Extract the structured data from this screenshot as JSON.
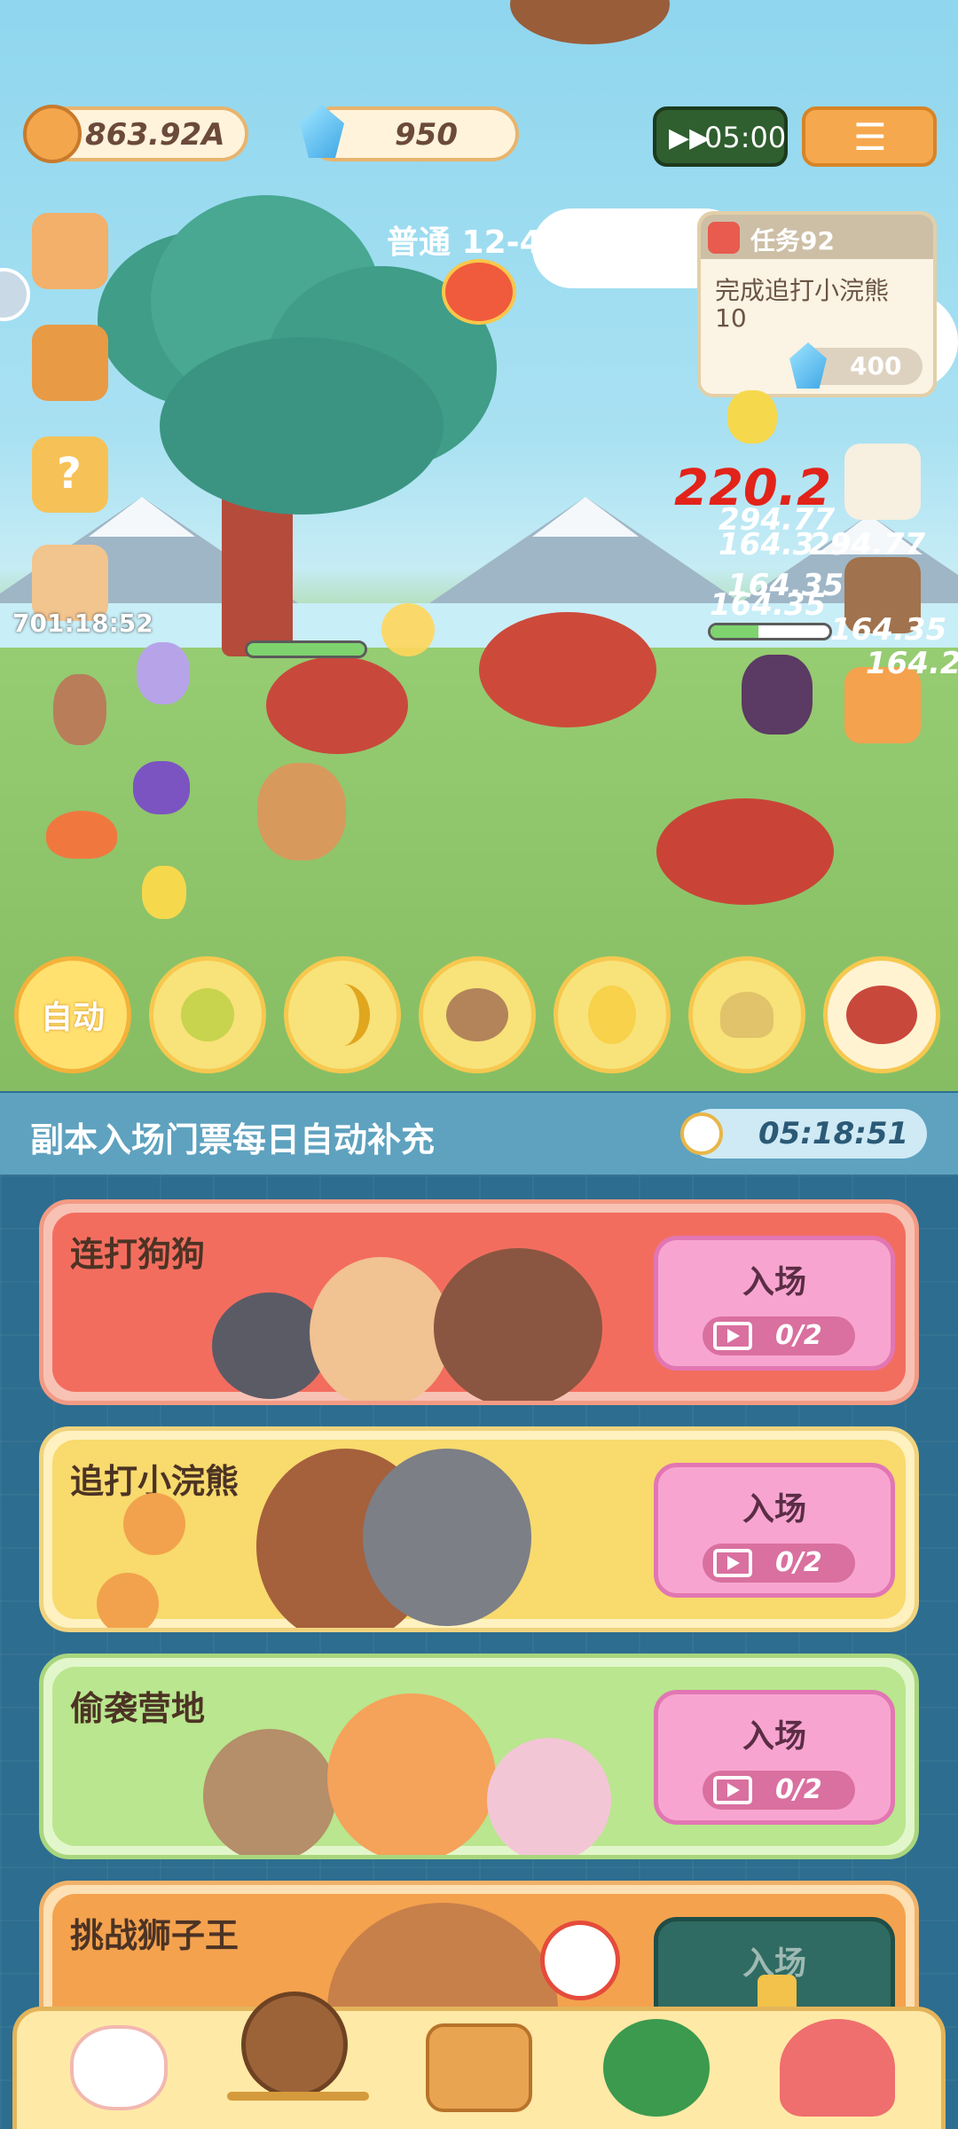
{
  "hud": {
    "coins": "863.92A",
    "gems": "950",
    "speed_timer": "05:00",
    "stage": "普通  12-4"
  },
  "side": {
    "timer": "701:18:52"
  },
  "quest": {
    "title": "任务92",
    "desc": "完成追打小浣熊",
    "count": "10",
    "reward": "400"
  },
  "battle": {
    "damage_numbers": [
      "220.2",
      "294.77",
      "164.3",
      "294.77",
      "164.35",
      "164.35",
      "164.35",
      "164.2"
    ]
  },
  "skills": {
    "auto_label": "自动",
    "items": [
      "slime-skill",
      "banana-skill",
      "hedgehog-skill",
      "egg-skill",
      "poop-skill",
      "bull-skill"
    ]
  },
  "tickets": {
    "banner_text": "副本入场门票每日自动补充",
    "refresh_timer": "05:18:51"
  },
  "dungeons": [
    {
      "title": "连打狗狗",
      "enter_label": "入场",
      "count": "0/2",
      "locked": false,
      "color": "#f36d5f"
    },
    {
      "title": "追打小浣熊",
      "enter_label": "入场",
      "count": "0/2",
      "locked": false,
      "color": "#f8da6d"
    },
    {
      "title": "偷袭营地",
      "enter_label": "入场",
      "count": "0/2",
      "locked": false,
      "color": "#b9e68e"
    },
    {
      "title": "挑战狮子王",
      "enter_label": "入场",
      "count": "",
      "locked": true,
      "color": "#f4a24e"
    }
  ],
  "nav": [
    "cat-home-icon",
    "battle-icon",
    "chest-icon",
    "tree-icon",
    "mushroom-house-icon"
  ]
}
